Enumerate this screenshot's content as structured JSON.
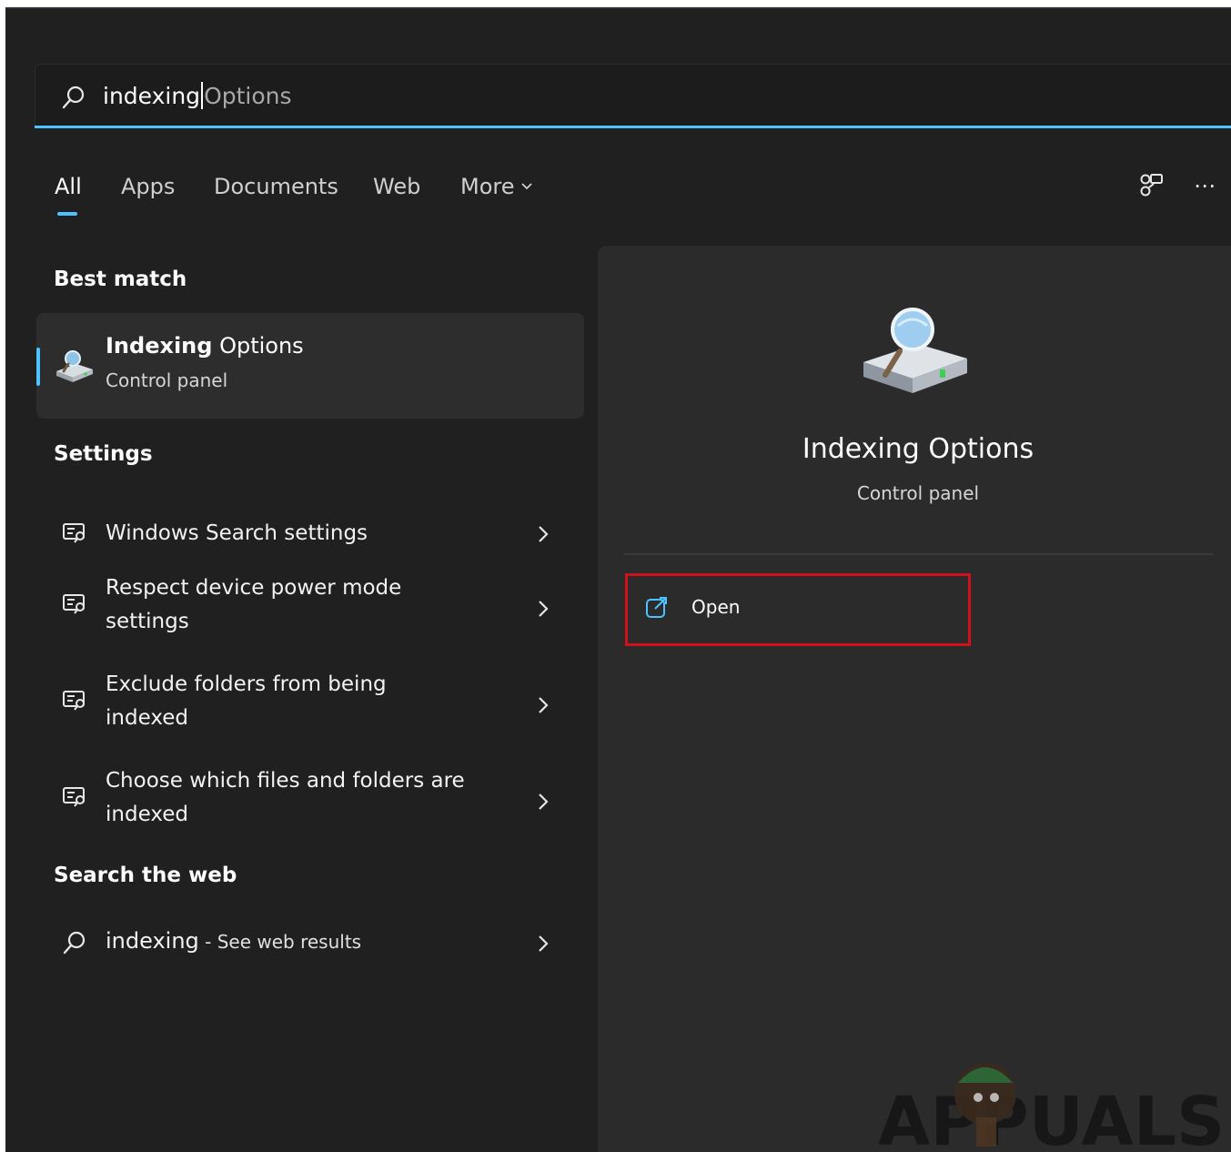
{
  "search": {
    "typed": "indexing",
    "completion": "Options"
  },
  "tabs": [
    {
      "label": "All"
    },
    {
      "label": "Apps"
    },
    {
      "label": "Documents"
    },
    {
      "label": "Web"
    },
    {
      "label": "More"
    }
  ],
  "results": {
    "best_match_title": "Best match",
    "best_match": {
      "name_bold": "Indexing",
      "name_rest": " Options",
      "subtitle": "Control panel",
      "icon": "indexing-options-icon"
    },
    "settings_title": "Settings",
    "settings": [
      {
        "label": "Windows Search settings"
      },
      {
        "label": "Respect device power mode settings"
      },
      {
        "label": "Exclude folders from being indexed"
      },
      {
        "label": "Choose which files and folders are indexed"
      }
    ],
    "web_title": "Search the web",
    "web": {
      "query": "indexing",
      "suffix": " - See web results"
    }
  },
  "preview": {
    "title": "Indexing Options",
    "subtitle": "Control panel",
    "open_label": "Open"
  },
  "watermark": {
    "text": "APPUALS"
  },
  "colors": {
    "background": "#202020",
    "pane": "#2b2b2b",
    "accent": "#4cc2ff",
    "highlight_box": "#d0111b"
  }
}
